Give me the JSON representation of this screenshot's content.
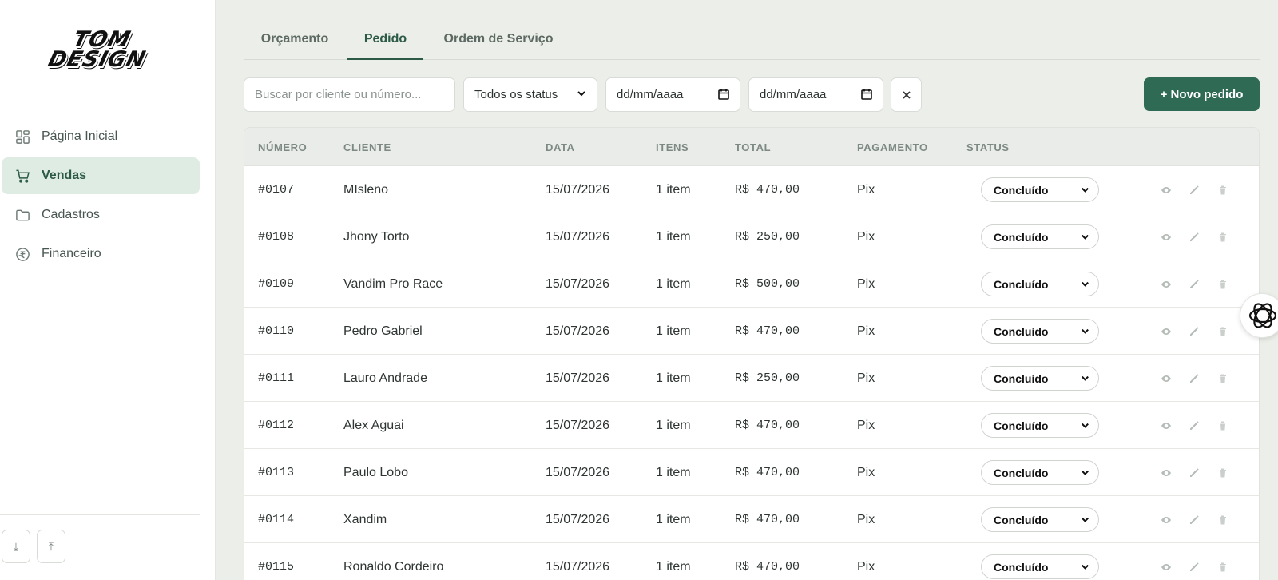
{
  "brand": {
    "logo_text": "TOM\nDESIGN"
  },
  "sidebar": {
    "items": [
      {
        "label": "Página Inicial",
        "icon": "layout-grid-icon",
        "active": false
      },
      {
        "label": "Vendas",
        "icon": "shopping-cart-icon",
        "active": true
      },
      {
        "label": "Cadastros",
        "icon": "folder-icon",
        "active": false
      },
      {
        "label": "Financeiro",
        "icon": "currency-circle-icon",
        "active": false
      }
    ],
    "footer_buttons": [
      {
        "icon": "download-icon",
        "glyph": "⤓"
      },
      {
        "icon": "upload-icon",
        "glyph": "⤒"
      }
    ]
  },
  "tabs": [
    {
      "label": "Orçamento",
      "active": false
    },
    {
      "label": "Pedido",
      "active": true
    },
    {
      "label": "Ordem de Serviço",
      "active": false
    }
  ],
  "filters": {
    "search_placeholder": "Buscar por cliente ou número...",
    "status_value": "Todos os status",
    "date_from_placeholder": "dd/mm/aaaa",
    "date_to_placeholder": "dd/mm/aaaa",
    "new_button": "+ Novo pedido"
  },
  "table": {
    "columns": [
      "NÚMERO",
      "CLIENTE",
      "DATA",
      "ITENS",
      "TOTAL",
      "PAGAMENTO",
      "STATUS"
    ],
    "rows": [
      {
        "numero": "#0107",
        "cliente": "MIsleno",
        "data": "15/07/2026",
        "itens": "1 item",
        "total": "R$ 470,00",
        "pagamento": "Pix",
        "status": "Concluído"
      },
      {
        "numero": "#0108",
        "cliente": "Jhony Torto",
        "data": "15/07/2026",
        "itens": "1 item",
        "total": "R$ 250,00",
        "pagamento": "Pix",
        "status": "Concluído"
      },
      {
        "numero": "#0109",
        "cliente": "Vandim Pro Race",
        "data": "15/07/2026",
        "itens": "1 item",
        "total": "R$ 500,00",
        "pagamento": "Pix",
        "status": "Concluído"
      },
      {
        "numero": "#0110",
        "cliente": "Pedro Gabriel",
        "data": "15/07/2026",
        "itens": "1 item",
        "total": "R$ 470,00",
        "pagamento": "Pix",
        "status": "Concluído"
      },
      {
        "numero": "#0111",
        "cliente": "Lauro Andrade",
        "data": "15/07/2026",
        "itens": "1 item",
        "total": "R$ 250,00",
        "pagamento": "Pix",
        "status": "Concluído"
      },
      {
        "numero": "#0112",
        "cliente": "Alex Aguai",
        "data": "15/07/2026",
        "itens": "1 item",
        "total": "R$ 470,00",
        "pagamento": "Pix",
        "status": "Concluído"
      },
      {
        "numero": "#0113",
        "cliente": "Paulo Lobo",
        "data": "15/07/2026",
        "itens": "1 item",
        "total": "R$ 470,00",
        "pagamento": "Pix",
        "status": "Concluído"
      },
      {
        "numero": "#0114",
        "cliente": "Xandim",
        "data": "15/07/2026",
        "itens": "1 item",
        "total": "R$ 470,00",
        "pagamento": "Pix",
        "status": "Concluído"
      },
      {
        "numero": "#0115",
        "cliente": "Ronaldo Cordeiro",
        "data": "15/07/2026",
        "itens": "1 item",
        "total": "R$ 470,00",
        "pagamento": "Pix",
        "status": "Concluído"
      }
    ],
    "row_actions": [
      "eye-icon",
      "pencil-icon",
      "trash-icon"
    ]
  },
  "colors": {
    "accent": "#2f6a55",
    "active_nav_bg": "#dfece4",
    "page_bg": "#eceee9"
  }
}
